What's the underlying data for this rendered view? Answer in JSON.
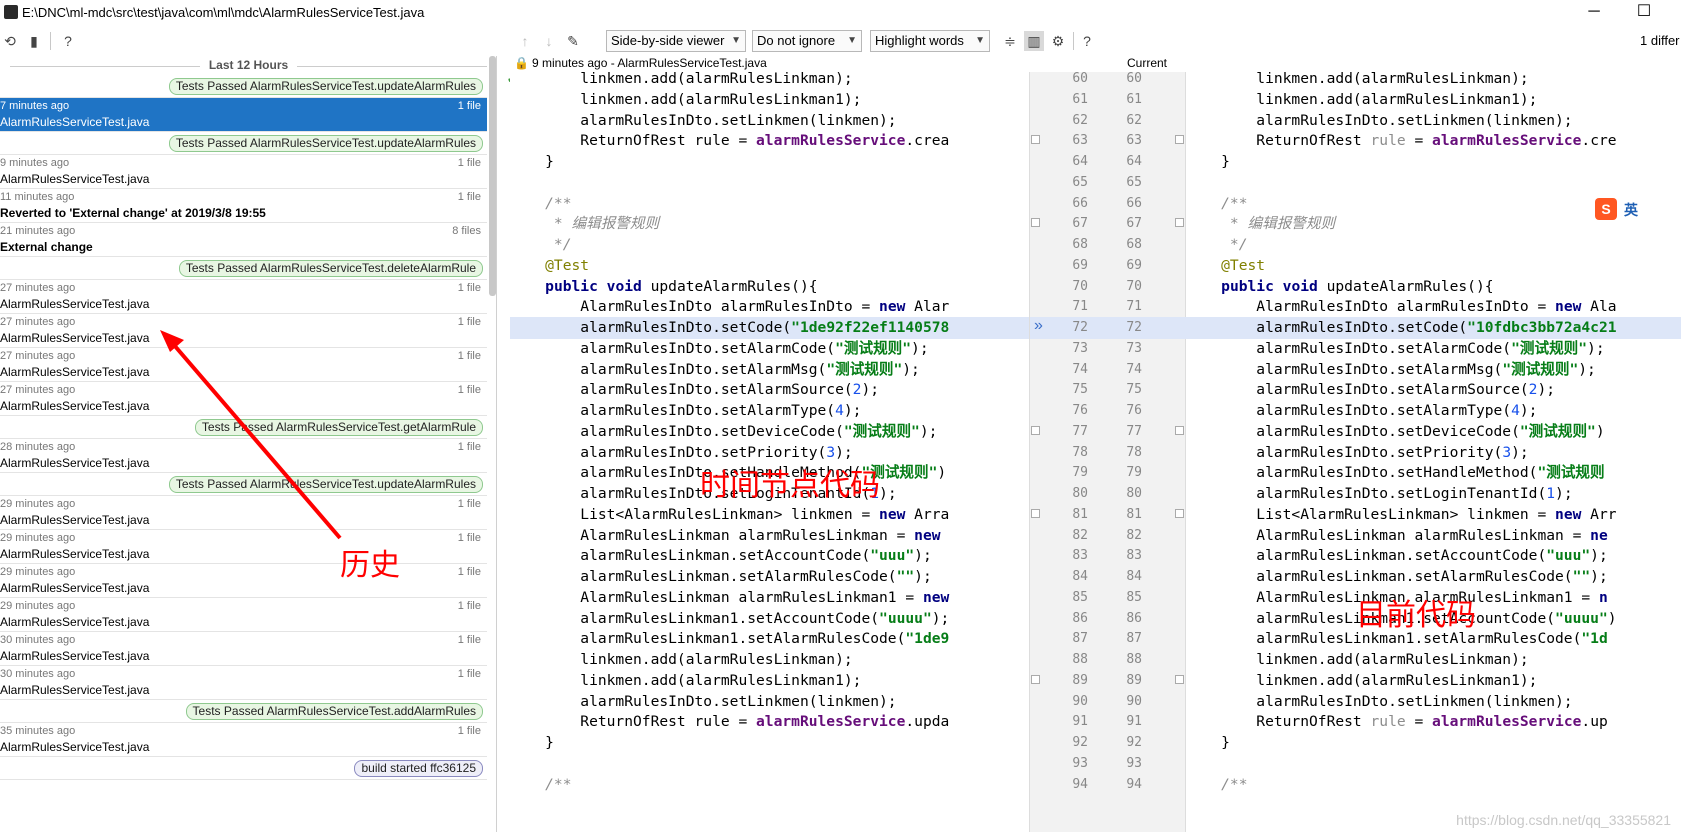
{
  "window": {
    "title": "E:\\DNC\\ml-mdc\\src\\test\\java\\com\\ml\\mdc\\AlarmRulesServiceTest.java"
  },
  "toolbar": {
    "viewer_mode": "Side-by-side viewer",
    "ignore_mode": "Do not ignore",
    "highlight_mode": "Highlight words",
    "diff_count": "1 differ"
  },
  "history": {
    "group_label": "Last 12 Hours",
    "items": [
      {
        "kind": "tag",
        "label": "Tests Passed AlarmRulesServiceTest.updateAlarmRules"
      },
      {
        "kind": "rev",
        "time": "7 minutes ago",
        "count": "1 file",
        "name": "AlarmRulesServiceTest.java",
        "selected": true
      },
      {
        "kind": "tag",
        "label": "Tests Passed AlarmRulesServiceTest.updateAlarmRules"
      },
      {
        "kind": "rev",
        "time": "9 minutes ago",
        "count": "1 file",
        "name": "AlarmRulesServiceTest.java"
      },
      {
        "kind": "rev",
        "time": "11 minutes ago",
        "count": "1 file",
        "name": "Reverted to 'External change' at 2019/3/8 19:55",
        "bold": true
      },
      {
        "kind": "rev",
        "time": "21 minutes ago",
        "count": "8 files",
        "name": "External change",
        "bold": true
      },
      {
        "kind": "tag",
        "label": "Tests Passed AlarmRulesServiceTest.deleteAlarmRule"
      },
      {
        "kind": "rev",
        "time": "27 minutes ago",
        "count": "1 file",
        "name": "AlarmRulesServiceTest.java"
      },
      {
        "kind": "rev",
        "time": "27 minutes ago",
        "count": "1 file",
        "name": "AlarmRulesServiceTest.java"
      },
      {
        "kind": "rev",
        "time": "27 minutes ago",
        "count": "1 file",
        "name": "AlarmRulesServiceTest.java"
      },
      {
        "kind": "rev",
        "time": "27 minutes ago",
        "count": "1 file",
        "name": "AlarmRulesServiceTest.java"
      },
      {
        "kind": "tag",
        "label": "Tests Passed AlarmRulesServiceTest.getAlarmRule"
      },
      {
        "kind": "rev",
        "time": "28 minutes ago",
        "count": "1 file",
        "name": "AlarmRulesServiceTest.java"
      },
      {
        "kind": "tag",
        "label": "Tests Passed AlarmRulesServiceTest.updateAlarmRules"
      },
      {
        "kind": "rev",
        "time": "29 minutes ago",
        "count": "1 file",
        "name": "AlarmRulesServiceTest.java"
      },
      {
        "kind": "rev",
        "time": "29 minutes ago",
        "count": "1 file",
        "name": "AlarmRulesServiceTest.java"
      },
      {
        "kind": "rev",
        "time": "29 minutes ago",
        "count": "1 file",
        "name": "AlarmRulesServiceTest.java"
      },
      {
        "kind": "rev",
        "time": "29 minutes ago",
        "count": "1 file",
        "name": "AlarmRulesServiceTest.java"
      },
      {
        "kind": "rev",
        "time": "30 minutes ago",
        "count": "1 file",
        "name": "AlarmRulesServiceTest.java"
      },
      {
        "kind": "rev",
        "time": "30 minutes ago",
        "count": "1 file",
        "name": "AlarmRulesServiceTest.java"
      },
      {
        "kind": "tag",
        "label": "Tests Passed AlarmRulesServiceTest.addAlarmRules"
      },
      {
        "kind": "rev",
        "time": "35 minutes ago",
        "count": "1 file",
        "name": "AlarmRulesServiceTest.java"
      },
      {
        "kind": "tag",
        "label": "build started ffc36125",
        "build": true
      }
    ]
  },
  "diff": {
    "left_header": "9 minutes ago - AlarmRulesServiceTest.java",
    "right_header": "Current",
    "line_numbers": [
      "60",
      "61",
      "62",
      "63",
      "64",
      "65",
      "66",
      "67",
      "68",
      "69",
      "70",
      "71",
      "72",
      "73",
      "74",
      "75",
      "76",
      "77",
      "78",
      "79",
      "80",
      "81",
      "82",
      "83",
      "84",
      "85",
      "86",
      "87",
      "88",
      "89",
      "90",
      "91",
      "92",
      "93",
      "94"
    ],
    "changed_line_index": 12,
    "left_lines": [
      [
        [
          "        linkmen.add(alarmRulesLinkman);",
          ""
        ]
      ],
      [
        [
          "        linkmen.add(alarmRulesLinkman1);",
          ""
        ]
      ],
      [
        [
          "        alarmRulesInDto.setLinkmen(linkmen);",
          ""
        ]
      ],
      [
        [
          "        ReturnOfRest rule = ",
          ""
        ],
        [
          "alarmRulesService",
          "fld"
        ],
        [
          ".crea",
          ""
        ]
      ],
      [
        [
          "    }",
          ""
        ]
      ],
      [
        [
          "",
          ""
        ]
      ],
      [
        [
          "    /**",
          "cmt"
        ]
      ],
      [
        [
          "     * 编辑报警规则",
          "cmt"
        ]
      ],
      [
        [
          "     */",
          "cmt"
        ]
      ],
      [
        [
          "    @Test",
          "ann"
        ]
      ],
      [
        [
          "    ",
          ""
        ],
        [
          "public void",
          "kw"
        ],
        [
          " updateAlarmRules(){",
          ""
        ]
      ],
      [
        [
          "        AlarmRulesInDto alarmRulesInDto = ",
          ""
        ],
        [
          "new",
          "kw"
        ],
        [
          " Alar",
          ""
        ]
      ],
      [
        [
          "        alarmRulesInDto.setCode(",
          ""
        ],
        [
          "\"1de92f22ef1140578",
          "str"
        ]
      ],
      [
        [
          "        alarmRulesInDto.setAlarmCode(",
          ""
        ],
        [
          "\"测试规则\"",
          "str"
        ],
        [
          ");",
          ""
        ]
      ],
      [
        [
          "        alarmRulesInDto.setAlarmMsg(",
          ""
        ],
        [
          "\"测试规则\"",
          "str"
        ],
        [
          ");",
          ""
        ]
      ],
      [
        [
          "        alarmRulesInDto.setAlarmSource(",
          ""
        ],
        [
          "2",
          "num"
        ],
        [
          ");",
          ""
        ]
      ],
      [
        [
          "        alarmRulesInDto.setAlarmType(",
          ""
        ],
        [
          "4",
          "num"
        ],
        [
          ");",
          ""
        ]
      ],
      [
        [
          "        alarmRulesInDto.setDeviceCode(",
          ""
        ],
        [
          "\"测试规则\"",
          "str"
        ],
        [
          ");",
          ""
        ]
      ],
      [
        [
          "        alarmRulesInDto.setPriority(",
          ""
        ],
        [
          "3",
          "num"
        ],
        [
          ");",
          ""
        ]
      ],
      [
        [
          "        alarmRulesInDto.setHandleMethod(",
          ""
        ],
        [
          "\"测试规则\"",
          "str"
        ],
        [
          ")",
          ""
        ]
      ],
      [
        [
          "        alarmRulesInDto.setLoginTenantId(",
          ""
        ],
        [
          "1",
          "num"
        ],
        [
          ");",
          ""
        ]
      ],
      [
        [
          "        List<AlarmRulesLinkman> linkmen = ",
          ""
        ],
        [
          "new",
          "kw"
        ],
        [
          " Arra",
          ""
        ]
      ],
      [
        [
          "        AlarmRulesLinkman alarmRulesLinkman = ",
          ""
        ],
        [
          "new",
          "kw"
        ]
      ],
      [
        [
          "        alarmRulesLinkman.setAccountCode(",
          ""
        ],
        [
          "\"uuu\"",
          "str"
        ],
        [
          ");",
          ""
        ]
      ],
      [
        [
          "        alarmRulesLinkman.setAlarmRulesCode(",
          ""
        ],
        [
          "\"\"",
          "str"
        ],
        [
          ");",
          ""
        ]
      ],
      [
        [
          "        AlarmRulesLinkman alarmRulesLinkman1 = ",
          ""
        ],
        [
          "new",
          "kw"
        ]
      ],
      [
        [
          "        alarmRulesLinkman1.setAccountCode(",
          ""
        ],
        [
          "\"uuuu\"",
          "str"
        ],
        [
          ");",
          ""
        ]
      ],
      [
        [
          "        alarmRulesLinkman1.setAlarmRulesCode(",
          ""
        ],
        [
          "\"1de9",
          "str"
        ]
      ],
      [
        [
          "        linkmen.add(alarmRulesLinkman);",
          ""
        ]
      ],
      [
        [
          "        linkmen.add(alarmRulesLinkman1);",
          ""
        ]
      ],
      [
        [
          "        alarmRulesInDto.setLinkmen(linkmen);",
          ""
        ]
      ],
      [
        [
          "        ReturnOfRest rule = ",
          ""
        ],
        [
          "alarmRulesService",
          "fld"
        ],
        [
          ".upda",
          ""
        ]
      ],
      [
        [
          "    }",
          ""
        ]
      ],
      [
        [
          "",
          ""
        ]
      ],
      [
        [
          "    /**",
          "cmt"
        ]
      ]
    ],
    "right_lines": [
      [
        [
          "        linkmen.add(alarmRulesLinkman);",
          ""
        ]
      ],
      [
        [
          "        linkmen.add(alarmRulesLinkman1);",
          ""
        ]
      ],
      [
        [
          "        alarmRulesInDto.setLinkmen(linkmen);",
          ""
        ]
      ],
      [
        [
          "        ReturnOfRest ",
          ""
        ],
        [
          "rule",
          "grey"
        ],
        [
          " = ",
          ""
        ],
        [
          "alarmRulesService",
          "fld"
        ],
        [
          ".cre",
          ""
        ]
      ],
      [
        [
          "    }",
          ""
        ]
      ],
      [
        [
          "",
          ""
        ]
      ],
      [
        [
          "    /**",
          "cmt"
        ]
      ],
      [
        [
          "     * 编辑报警规则",
          "cmt"
        ]
      ],
      [
        [
          "     */",
          "cmt"
        ]
      ],
      [
        [
          "    @Test",
          "ann"
        ]
      ],
      [
        [
          "    ",
          ""
        ],
        [
          "public void",
          "kw"
        ],
        [
          " updateAlarmRules(){",
          ""
        ]
      ],
      [
        [
          "        AlarmRulesInDto alarmRulesInDto = ",
          ""
        ],
        [
          "new",
          "kw"
        ],
        [
          " Ala",
          ""
        ]
      ],
      [
        [
          "        alarmRulesInDto.setCode(",
          ""
        ],
        [
          "\"10fdbc3bb72a4c21",
          "str"
        ]
      ],
      [
        [
          "        alarmRulesInDto.setAlarmCode(",
          ""
        ],
        [
          "\"测试规则\"",
          "str"
        ],
        [
          ");",
          ""
        ]
      ],
      [
        [
          "        alarmRulesInDto.setAlarmMsg(",
          ""
        ],
        [
          "\"测试规则\"",
          "str"
        ],
        [
          ");",
          ""
        ]
      ],
      [
        [
          "        alarmRulesInDto.setAlarmSource(",
          ""
        ],
        [
          "2",
          "num"
        ],
        [
          ");",
          ""
        ]
      ],
      [
        [
          "        alarmRulesInDto.setAlarmType(",
          ""
        ],
        [
          "4",
          "num"
        ],
        [
          ");",
          ""
        ]
      ],
      [
        [
          "        alarmRulesInDto.setDeviceCode(",
          ""
        ],
        [
          "\"测试规则\"",
          "str"
        ],
        [
          ")",
          ""
        ]
      ],
      [
        [
          "        alarmRulesInDto.setPriority(",
          ""
        ],
        [
          "3",
          "num"
        ],
        [
          ");",
          ""
        ]
      ],
      [
        [
          "        alarmRulesInDto.setHandleMethod(",
          ""
        ],
        [
          "\"测试规则",
          "str"
        ]
      ],
      [
        [
          "        alarmRulesInDto.setLoginTenantId(",
          ""
        ],
        [
          "1",
          "num"
        ],
        [
          ");",
          ""
        ]
      ],
      [
        [
          "        List<AlarmRulesLinkman> linkmen = ",
          ""
        ],
        [
          "new",
          "kw"
        ],
        [
          " Arr",
          ""
        ]
      ],
      [
        [
          "        AlarmRulesLinkman alarmRulesLinkman = ",
          ""
        ],
        [
          "ne",
          "kw"
        ]
      ],
      [
        [
          "        alarmRulesLinkman.setAccountCode(",
          ""
        ],
        [
          "\"uuu\"",
          "str"
        ],
        [
          ");",
          ""
        ]
      ],
      [
        [
          "        alarmRulesLinkman.setAlarmRulesCode(",
          ""
        ],
        [
          "\"\"",
          "str"
        ],
        [
          ");",
          ""
        ]
      ],
      [
        [
          "        AlarmRulesLinkman alarmRulesLinkman1 = ",
          ""
        ],
        [
          "n",
          "kw"
        ]
      ],
      [
        [
          "        alarmRulesLinkman1.setAccountCode(",
          ""
        ],
        [
          "\"uuuu\"",
          "str"
        ],
        [
          ")",
          ""
        ]
      ],
      [
        [
          "        alarmRulesLinkman1.setAlarmRulesCode(",
          ""
        ],
        [
          "\"1d",
          "str"
        ]
      ],
      [
        [
          "        linkmen.add(alarmRulesLinkman);",
          ""
        ]
      ],
      [
        [
          "        linkmen.add(alarmRulesLinkman1);",
          ""
        ]
      ],
      [
        [
          "        alarmRulesInDto.setLinkmen(linkmen);",
          ""
        ]
      ],
      [
        [
          "        ReturnOfRest ",
          ""
        ],
        [
          "rule",
          "grey"
        ],
        [
          " = ",
          ""
        ],
        [
          "alarmRulesService",
          "fld"
        ],
        [
          ".up",
          ""
        ]
      ],
      [
        [
          "    }",
          ""
        ]
      ],
      [
        [
          "",
          ""
        ]
      ],
      [
        [
          "    /**",
          "cmt"
        ]
      ]
    ]
  },
  "annotations": {
    "history_label": "历史",
    "past_code_label": "时间节点代码",
    "current_code_label": "目前代码"
  },
  "ime": {
    "label": "英"
  },
  "watermark": "https://blog.csdn.net/qq_33355821",
  "colors": {
    "selection": "#1f74c5",
    "changed_line": "#dde6f8",
    "annotation": "#ff0000"
  }
}
